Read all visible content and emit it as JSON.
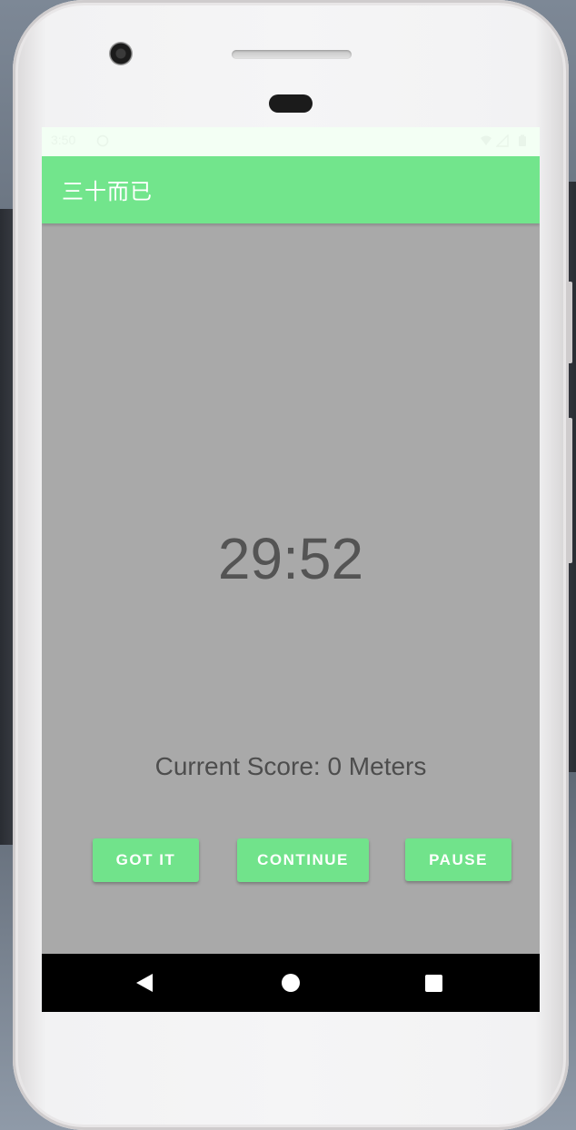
{
  "status_bar": {
    "time": "3:50"
  },
  "app_bar": {
    "title": "三十而已"
  },
  "main": {
    "timer": "29:52",
    "score": "Current Score: 0 Meters"
  },
  "buttons": {
    "got_it": "GOT IT",
    "continue": "CONTINUE",
    "pause": "PAUSE"
  },
  "nav": {
    "back": "back-icon",
    "home": "home-icon",
    "recents": "recents-icon"
  },
  "colors": {
    "accent_green": "#72e58c",
    "content_background": "#a9a9a9",
    "nav_background": "#000000"
  }
}
